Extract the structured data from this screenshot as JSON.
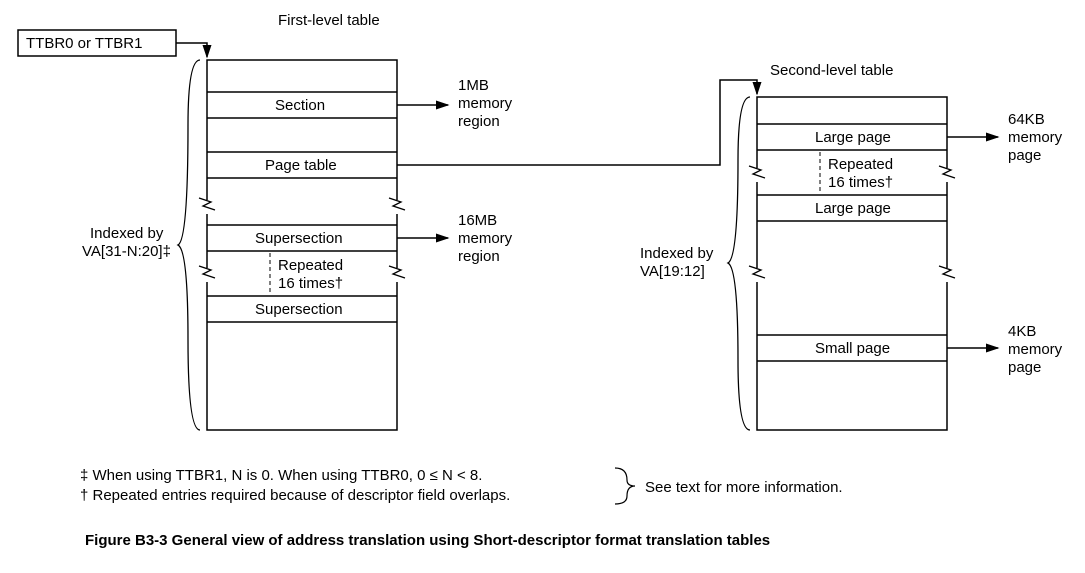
{
  "ttbr": "TTBR0 or TTBR1",
  "level1": {
    "title": "First-level table",
    "section": "Section",
    "pageTable": "Page table",
    "supersection": "Supersection",
    "repeated_a": "Repeated",
    "repeated_b": "16 times†",
    "indexA": "Indexed by",
    "indexB": "VA[31-N:20]‡",
    "region1mb_a": "1MB",
    "region1mb_b": "memory",
    "region1mb_c": "region",
    "region16mb_a": "16MB",
    "region16mb_b": "memory",
    "region16mb_c": "region"
  },
  "level2": {
    "title": "Second-level table",
    "large": "Large page",
    "small": "Small page",
    "repeated_a": "Repeated",
    "repeated_b": "16 times†",
    "indexA": "Indexed by",
    "indexB": "VA[19:12]",
    "p64_a": "64KB",
    "p64_b": "memory",
    "p64_c": "page",
    "p4_a": "4KB",
    "p4_b": "memory",
    "p4_c": "page"
  },
  "footnotes": {
    "dagger": "‡ When using TTBR1, N is 0. When using TTBR0, 0 ≤ N < 8.",
    "cross": "† Repeated entries required because of descriptor field overlaps.",
    "see": "See text for more information."
  },
  "caption": "Figure B3-3 General view of address translation using Short-descriptor format translation tables"
}
